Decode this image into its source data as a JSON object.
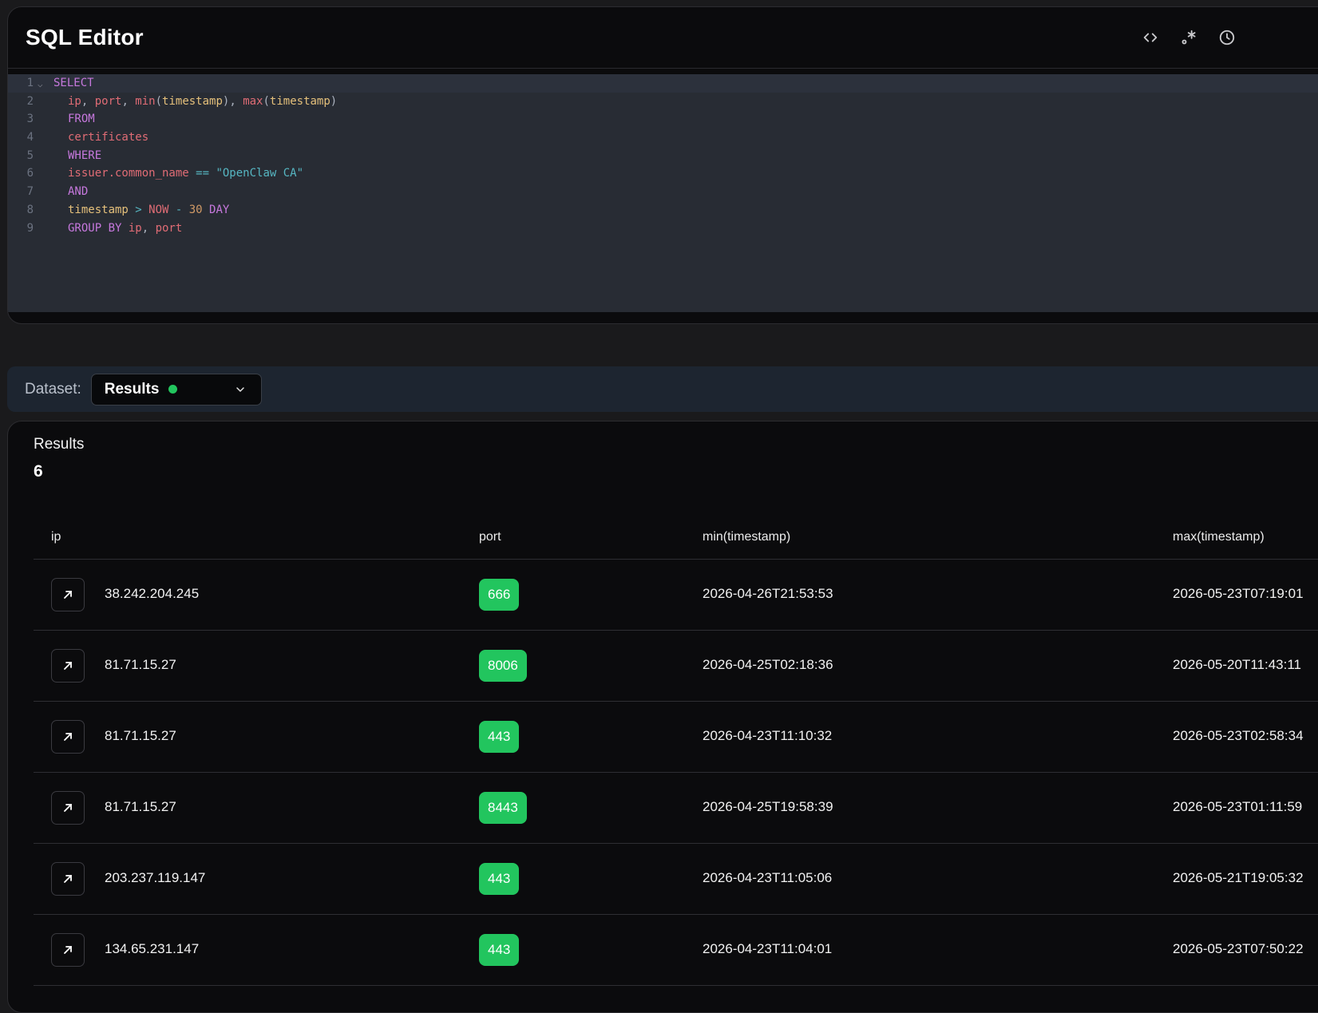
{
  "editor": {
    "title": "SQL Editor",
    "header_icons": [
      "code-icon",
      "regex-icon",
      "history-icon"
    ],
    "line_numbers": [
      "1",
      "2",
      "3",
      "4",
      "5",
      "6",
      "7",
      "8",
      "9"
    ],
    "code": {
      "l1": "SELECT",
      "l2": {
        "ip": "ip",
        "c1": ", ",
        "port": "port",
        "c2": ", ",
        "min": "min",
        "p1": "(",
        "ts1": "timestamp",
        "p2": "), ",
        "max": "max",
        "p3": "(",
        "ts2": "timestamp",
        "p4": ")"
      },
      "l3": "FROM",
      "l4": "certificates",
      "l5": "WHERE",
      "l6": {
        "field": "issuer.common_name",
        "op": " == ",
        "value": "\"OpenClaw CA\""
      },
      "l7": "AND",
      "l8": {
        "field": "timestamp",
        "gt": " > ",
        "now": "NOW",
        "minus": " - ",
        "num": "30",
        "unit": " DAY"
      },
      "l9": {
        "kw": "GROUP BY ",
        "ip": "ip",
        "comma": ", ",
        "port": "port"
      }
    }
  },
  "dataset": {
    "label": "Dataset:",
    "selected": "Results",
    "status_color": "#22c55e"
  },
  "results": {
    "title": "Results",
    "count": "6",
    "columns": [
      "ip",
      "port",
      "min(timestamp)",
      "max(timestamp)"
    ],
    "rows": [
      {
        "ip": "38.242.204.245",
        "port": "666",
        "min": "2026-04-26T21:53:53",
        "max": "2026-05-23T07:19:01"
      },
      {
        "ip": "81.71.15.27",
        "port": "8006",
        "min": "2026-04-25T02:18:36",
        "max": "2026-05-20T11:43:11"
      },
      {
        "ip": "81.71.15.27",
        "port": "443",
        "min": "2026-04-23T11:10:32",
        "max": "2026-05-23T02:58:34"
      },
      {
        "ip": "81.71.15.27",
        "port": "8443",
        "min": "2026-04-25T19:58:39",
        "max": "2026-05-23T01:11:59"
      },
      {
        "ip": "203.237.119.147",
        "port": "443",
        "min": "2026-04-23T11:05:06",
        "max": "2026-05-21T19:05:32"
      },
      {
        "ip": "134.65.231.147",
        "port": "443",
        "min": "2026-04-23T11:04:01",
        "max": "2026-05-23T07:50:22"
      }
    ]
  },
  "colors": {
    "accent_green": "#22c55e",
    "keyword": "#c678dd",
    "identifier": "#e06c75",
    "argument": "#e5c07b",
    "string": "#56b6c2"
  }
}
